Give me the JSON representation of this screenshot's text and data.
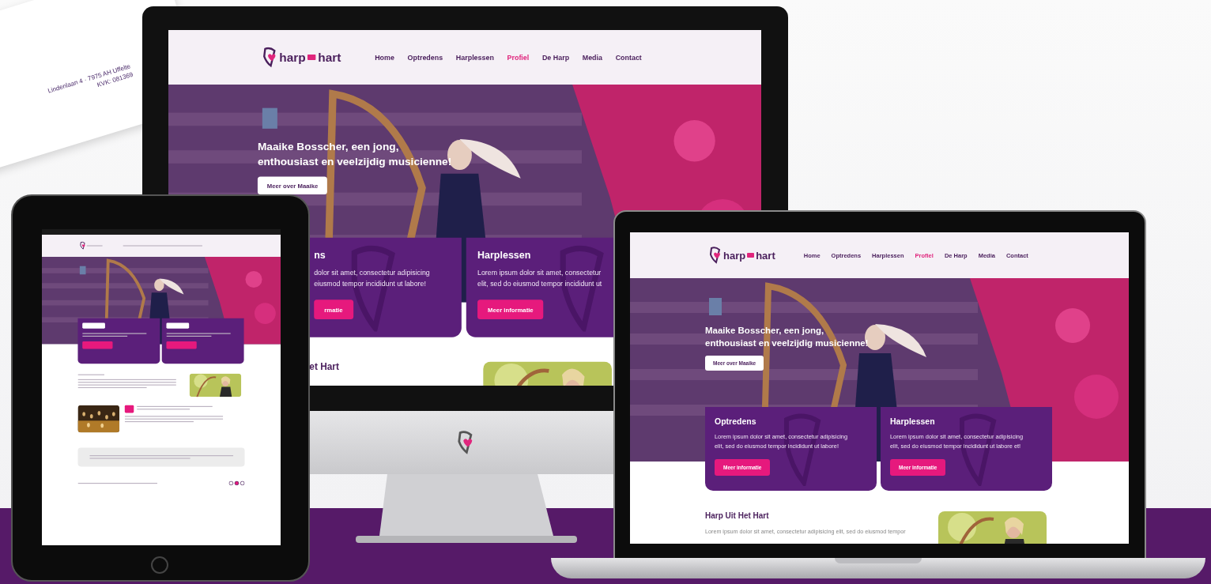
{
  "letter": {
    "lines": [
      "Lindenlaan 4 · 7975 AH Uffelte",
      "KVK: 081369"
    ]
  },
  "devices": [
    {
      "kind": "monitor",
      "site": {
        "logo": [
          "harp",
          "hart"
        ],
        "nav": [
          {
            "label": "Home",
            "selected": false
          },
          {
            "label": "Optredens",
            "selected": false
          },
          {
            "label": "Harplessen",
            "selected": false
          },
          {
            "label": "Profiel",
            "selected": true
          },
          {
            "label": "De Harp",
            "selected": false
          },
          {
            "label": "Media",
            "selected": false
          },
          {
            "label": "Contact",
            "selected": false
          }
        ],
        "hero": {
          "title_lines": [
            "Maaike Bosscher, een jong,",
            "enthousiast en veelzijdig musicienne!"
          ],
          "button": "Meer over Maaike"
        },
        "cards": [
          {
            "title": "ns",
            "text_lines": [
              "dolor sit amet, consectetur adipisicing",
              "eiusmod tempor incididunt ut labore!"
            ],
            "button": "rmatie",
            "cut_left": true
          },
          {
            "title": "Harplessen",
            "text_lines": [
              "Lorem ipsum dolor sit amet, consectetur",
              "elit, sed do eiusmod tempor incididunt ut"
            ],
            "button": "Meer informatie",
            "cut_left": false
          }
        ],
        "section": {
          "title": "et Hart",
          "cut_left": true
        }
      }
    },
    {
      "kind": "tablet"
    },
    {
      "kind": "laptop",
      "site": {
        "logo": [
          "harp",
          "hart"
        ],
        "nav": [
          {
            "label": "Home",
            "selected": false
          },
          {
            "label": "Optredens",
            "selected": false
          },
          {
            "label": "Harplessen",
            "selected": false
          },
          {
            "label": "Profiel",
            "selected": true
          },
          {
            "label": "De Harp",
            "selected": false
          },
          {
            "label": "Media",
            "selected": false
          },
          {
            "label": "Contact",
            "selected": false
          }
        ],
        "hero": {
          "title_lines": [
            "Maaike Bosscher, een jong,",
            "enthousiast en veelzijdig musicienne!"
          ],
          "button": "Meer over Maaike"
        },
        "cards": [
          {
            "title": "Optredens",
            "text_lines": [
              "Lorem ipsum dolor sit amet, consectetur adipisicing",
              "elit, sed do eiusmod tempor incididunt ut labore!"
            ],
            "button": "Meer informatie",
            "cut_left": false
          },
          {
            "title": "Harplessen",
            "text_lines": [
              "Lorem ipsum dolor sit amet, consectetur adipisicing",
              "elit, sed do eiusmod tempor incididunt ut labore et!"
            ],
            "button": "Meer informatie",
            "cut_left": false
          }
        ],
        "section": {
          "title": "Harp Uit Het Hart",
          "text": "Lorem ipsum dolor sit amet, consectetur adipisicing elit, sed do eiusmod tempor",
          "cut_left": false
        }
      }
    }
  ]
}
